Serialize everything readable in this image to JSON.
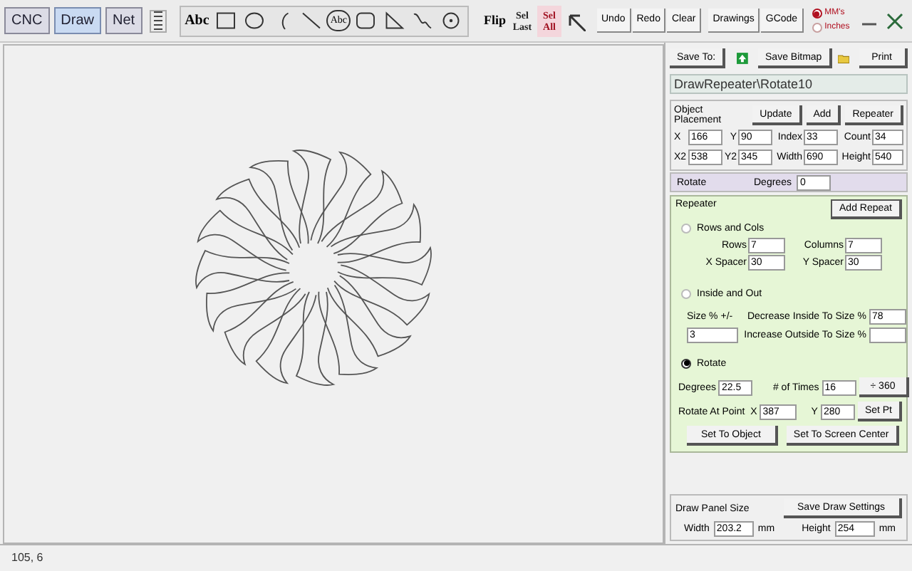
{
  "tabs": [
    {
      "label": "CNC",
      "selected": false
    },
    {
      "label": "Draw",
      "selected": true
    },
    {
      "label": "Net",
      "selected": false
    }
  ],
  "tools": [
    {
      "kind": "text",
      "label": "Abc"
    },
    {
      "kind": "rect"
    },
    {
      "kind": "ellipse"
    },
    {
      "kind": "arc"
    },
    {
      "kind": "line"
    },
    {
      "kind": "circled_text",
      "label": "Abc"
    },
    {
      "kind": "rounded_rect"
    },
    {
      "kind": "triangle"
    },
    {
      "kind": "curve"
    },
    {
      "kind": "target"
    }
  ],
  "select_tools": [
    {
      "kind": "flip",
      "label": "Flip"
    },
    {
      "kind": "stacked",
      "label": "Sel",
      "sublabel": "Last"
    },
    {
      "kind": "stacked_alert",
      "label": "Sel",
      "sublabel": "All"
    },
    {
      "kind": "pointer"
    }
  ],
  "buttons": [
    "Undo",
    "Redo",
    "Clear",
    "Drawings",
    "GCode"
  ],
  "units": [
    {
      "label": "MM's",
      "selected": true
    },
    {
      "label": "Inches",
      "selected": false
    }
  ],
  "panel": {
    "save_to": "Save To:",
    "save_bitmap": "Save Bitmap",
    "print": "Print",
    "file_name": "DrawRepeater\\Rotate10",
    "object_placement": {
      "title": "Object Placement",
      "buttons": [
        "Update",
        "Add",
        "Repeater"
      ],
      "fields": [
        {
          "label": "X",
          "value": "166"
        },
        {
          "label": "Y",
          "value": "90"
        },
        {
          "label": "Index",
          "value": "33"
        },
        {
          "label": "Count",
          "value": "34"
        },
        {
          "label": "X2",
          "value": "538"
        },
        {
          "label": "Y2",
          "value": "345"
        },
        {
          "label": "Width",
          "value": "690"
        },
        {
          "label": "Height",
          "value": "540"
        }
      ]
    },
    "rotate": {
      "label": "Rotate",
      "field": {
        "label": "Degrees",
        "value": "0"
      }
    },
    "repeater": {
      "title": "Repeater",
      "add_button": "Add Repeat",
      "modes": [
        {
          "label": "Rows and Cols",
          "selected": false,
          "fields": [
            {
              "label": "Rows",
              "value": "7"
            },
            {
              "label": "Columns",
              "value": "7"
            },
            {
              "label": "X Spacer",
              "value": "30"
            },
            {
              "label": "Y Spacer",
              "value": "30"
            }
          ]
        },
        {
          "label": "Inside and Out",
          "selected": false,
          "fields": [
            {
              "label": "Size % +/-",
              "value": "3"
            },
            {
              "label": "Decrease Inside To Size %",
              "value": "78"
            },
            {
              "label": "Increase Outside To Size %"
            }
          ]
        },
        {
          "label": "Rotate",
          "selected": true,
          "fields": [
            {
              "label": "Degrees",
              "value": "22.5"
            },
            {
              "label": "# of Times",
              "value": "16"
            },
            {
              "label": "Rotate At Point  X",
              "value": "387"
            },
            {
              "label": "Y",
              "value": "280"
            }
          ],
          "buttons": [
            "÷ 360",
            "Set Pt",
            "Set To Object",
            "Set To Screen Center"
          ]
        }
      ]
    },
    "draw_panel": {
      "title": "Draw Panel Size",
      "button": "Save Draw Settings",
      "fields": [
        {
          "label": "Width",
          "value": "203.2",
          "unit": "mm"
        },
        {
          "label": "Height",
          "value": "254",
          "unit": "mm"
        }
      ]
    }
  },
  "status_bar": "105, 6"
}
